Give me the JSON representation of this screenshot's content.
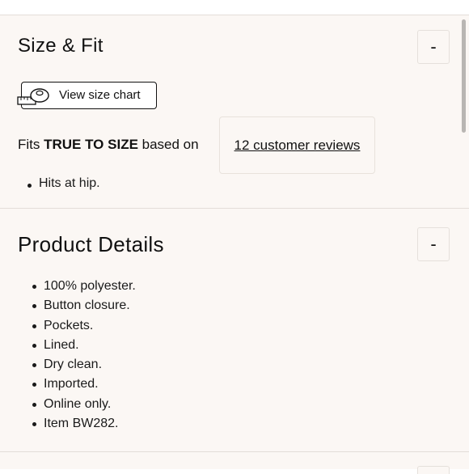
{
  "size_fit": {
    "title": "Size & Fit",
    "toggle_symbol": "-",
    "size_chart_button": {
      "label": "View size chart",
      "icon": "measuring-tape-icon"
    },
    "fit_prefix": "Fits ",
    "fit_emphasis": "TRUE TO SIZE",
    "fit_suffix": " based on",
    "reviews_link": "12 customer reviews",
    "bullets": [
      "Hits at hip."
    ]
  },
  "product_details": {
    "title": "Product Details",
    "toggle_symbol": "-",
    "bullets": [
      "100% polyester.",
      "Button closure.",
      "Pockets.",
      "Lined.",
      "Dry clean.",
      "Imported.",
      "Online only.",
      "Item BW282."
    ]
  },
  "colors": {
    "panel_bg": "#fbf7f4",
    "divider": "#e3ddd8",
    "text": "#111111"
  }
}
